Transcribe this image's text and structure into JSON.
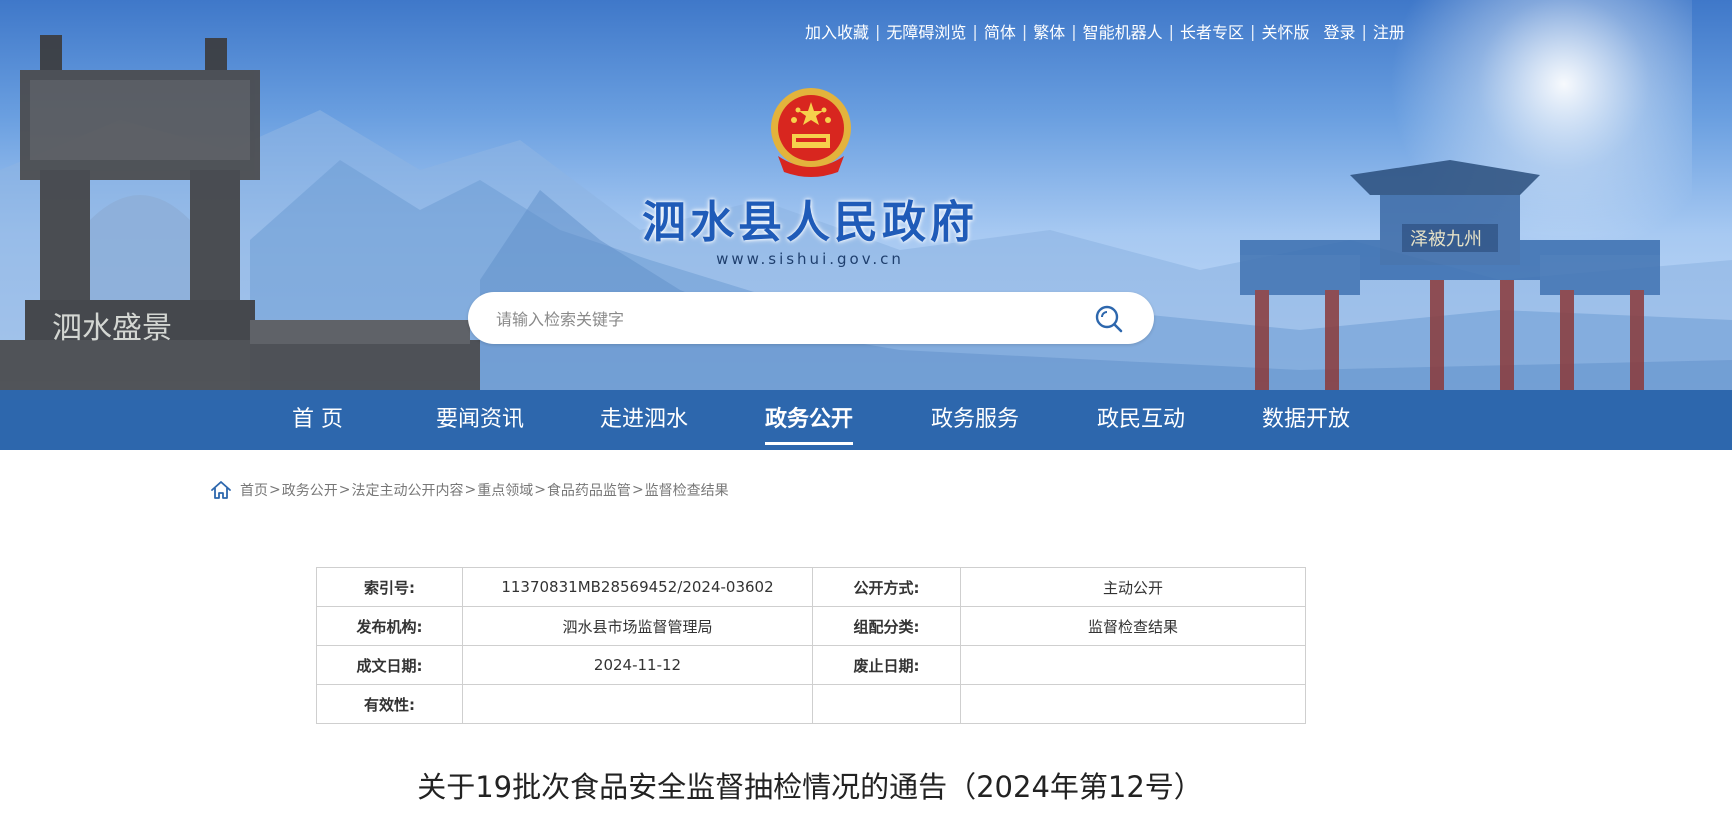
{
  "header": {
    "top_links": [
      "加入收藏",
      "无障碍浏览",
      "简体",
      "繁体",
      "智能机器人",
      "长者专区",
      "关怀版",
      "登录",
      "注册"
    ],
    "site_name": "泗水县人民政府",
    "site_url": "www.sishui.gov.cn",
    "search_placeholder": "请输入检索关键字",
    "banner_left_inscription": "泗水盛景",
    "banner_right_inscription": "泽被九州"
  },
  "nav": {
    "items": [
      "首 页",
      "要闻资讯",
      "走进泗水",
      "政务公开",
      "政务服务",
      "政民互动",
      "数据开放"
    ],
    "active": "政务公开"
  },
  "breadcrumb": {
    "items": [
      "首页",
      "政务公开",
      "法定主动公开内容",
      "重点领域",
      "食品药品监管",
      "监督检查结果"
    ],
    "separator": ">"
  },
  "meta_table": {
    "rows": [
      {
        "label1": "索引号:",
        "value1": "11370831MB28569452/2024-03602",
        "label2": "公开方式:",
        "value2": "主动公开"
      },
      {
        "label1": "发布机构:",
        "value1": "泗水县市场监督管理局",
        "label2": "组配分类:",
        "value2": "监督检查结果"
      },
      {
        "label1": "成文日期:",
        "value1": "2024-11-12",
        "label2": "废止日期:",
        "value2": ""
      },
      {
        "label1": "有效性:",
        "value1": "",
        "label2": "",
        "value2": ""
      }
    ]
  },
  "article": {
    "title": "关于19批次食品安全监督抽检情况的通告（2024年第12号）"
  },
  "icons": {
    "search": "search-icon",
    "home": "home-icon",
    "emblem": "national-emblem-icon"
  },
  "colors": {
    "nav_bg": "#2d67ad",
    "site_name": "#1f5bb8",
    "banner_top": "#3f78c9"
  }
}
